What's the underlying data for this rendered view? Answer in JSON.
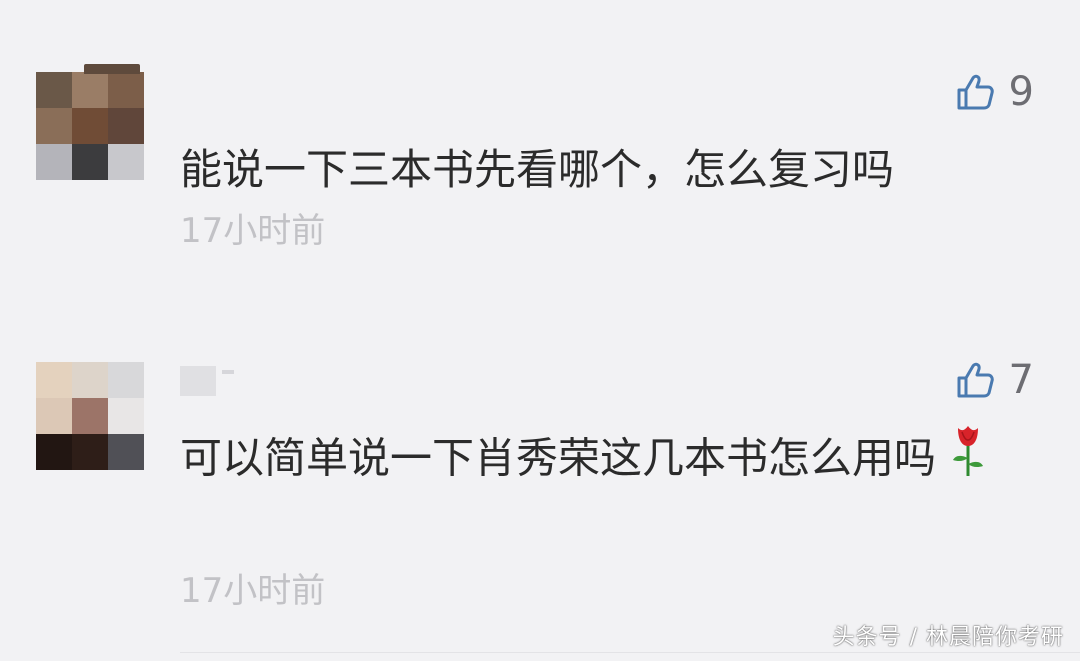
{
  "comments": [
    {
      "likes": "9",
      "text": "能说一下三本书先看哪个，怎么复习吗",
      "time": "17小时前",
      "avatar_tiles": [
        "#6a5848",
        "#9a7d66",
        "#7c5e49",
        "#8a6e58",
        "#704c36",
        "#60463a",
        "#b4b4ba",
        "#3c3c3e",
        "#c8c8cc"
      ]
    },
    {
      "likes": "7",
      "text": "可以简单说一下肖秀荣这几本书怎么用吗",
      "time": "17小时前",
      "avatar_tiles": [
        "#e4d2be",
        "#ddd4ca",
        "#d8d8da",
        "#dcc8b6",
        "#9c7468",
        "#e8e6e6",
        "#221612",
        "#2e1e18",
        "#505056"
      ]
    }
  ],
  "icons": {
    "like": "thumbs-up-icon",
    "emoji": "rose-icon"
  },
  "colors": {
    "background": "#f2f2f4",
    "text": "#2b2b2b",
    "time": "#c2c2c6",
    "like_icon": "#4a7ab0",
    "count": "#6d6d72"
  },
  "watermark": "头条号 / 林晨陪你考研"
}
